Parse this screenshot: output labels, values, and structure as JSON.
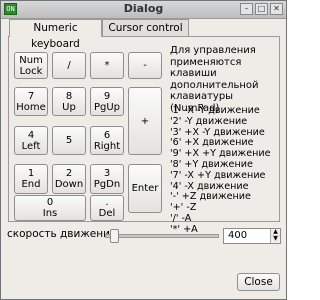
{
  "window": {
    "title": "Dialog",
    "app_icon_text": "ON",
    "minimize_glyph": "–",
    "maximize_glyph": "□",
    "close_glyph": "✕"
  },
  "tabs": [
    {
      "label": "Numeric keyboard",
      "active": true
    },
    {
      "label": "Cursor control",
      "active": false
    }
  ],
  "keypad": {
    "num_lock": {
      "line1": "Num",
      "line2": "Lock"
    },
    "divide": "/",
    "multiply": "*",
    "minus": "-",
    "k7": {
      "line1": "7",
      "line2": "Home"
    },
    "k8": {
      "line1": "8",
      "line2": "Up"
    },
    "k9": {
      "line1": "9",
      "line2": "PgUp"
    },
    "plus": "+",
    "k4": {
      "line1": "4",
      "line2": "Left"
    },
    "k5": "5",
    "k6": {
      "line1": "6",
      "line2": "Right"
    },
    "k1": {
      "line1": "1",
      "line2": "End"
    },
    "k2": {
      "line1": "2",
      "line2": "Down"
    },
    "k3": {
      "line1": "3",
      "line2": "PgDn"
    },
    "enter": "Enter",
    "k0": {
      "line1": "0",
      "line2": "Ins"
    },
    "dot": {
      "line1": ".",
      "line2": "Del"
    }
  },
  "help_text": "Для управления\nприменяются клавиши\nдополнительной\nклавиатуры (NumPad)",
  "legend": [
    "'1' -X -Y движение",
    "'2' -Y движение",
    "'3' +X -Y движение",
    "'6' +X движение",
    "'9' +X +Y движение",
    "'8' +Y движение",
    "'7' -X +Y движение",
    "'4' -X движение",
    "'-' +Z движение",
    "'+' -Z",
    "'/' -A",
    "'*' +A"
  ],
  "speed": {
    "label": "скорость движения",
    "value": "400",
    "slider_fraction": 0.05,
    "up_glyph": "▲",
    "down_glyph": "▼"
  },
  "close_button": "Close"
}
